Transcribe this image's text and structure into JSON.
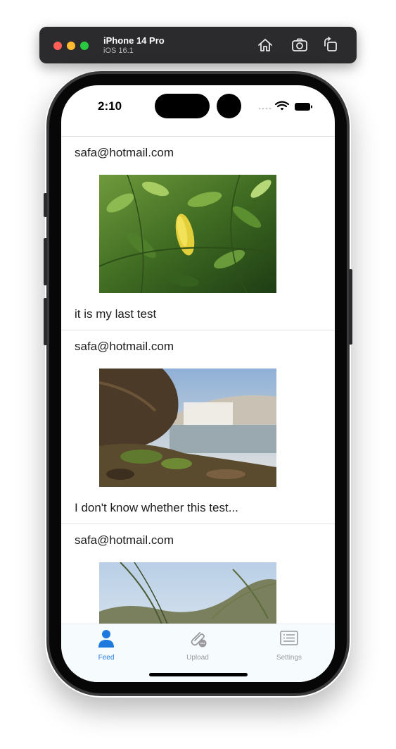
{
  "window": {
    "device_name": "iPhone 14 Pro",
    "os_version": "iOS 16.1"
  },
  "status_bar": {
    "time": "2:10"
  },
  "posts": [
    {
      "user": "safa@hotmail.com",
      "caption": "it is my last test",
      "image": "leaves-photo"
    },
    {
      "user": "safa@hotmail.com",
      "caption": "I don't know whether this test...",
      "image": "waterfall-photo"
    },
    {
      "user": "safa@hotmail.com",
      "caption": "",
      "image": "grass-photo"
    }
  ],
  "tabs": [
    {
      "label": "Feed",
      "icon": "person-icon",
      "selected": true
    },
    {
      "label": "Upload",
      "icon": "paperclip-icon",
      "selected": false
    },
    {
      "label": "Settings",
      "icon": "list-icon",
      "selected": false
    }
  ],
  "colors": {
    "accent": "#1f7ae0",
    "inactive_tab": "#9a9a9e",
    "tabbar_bg": "#f6fbfd"
  }
}
